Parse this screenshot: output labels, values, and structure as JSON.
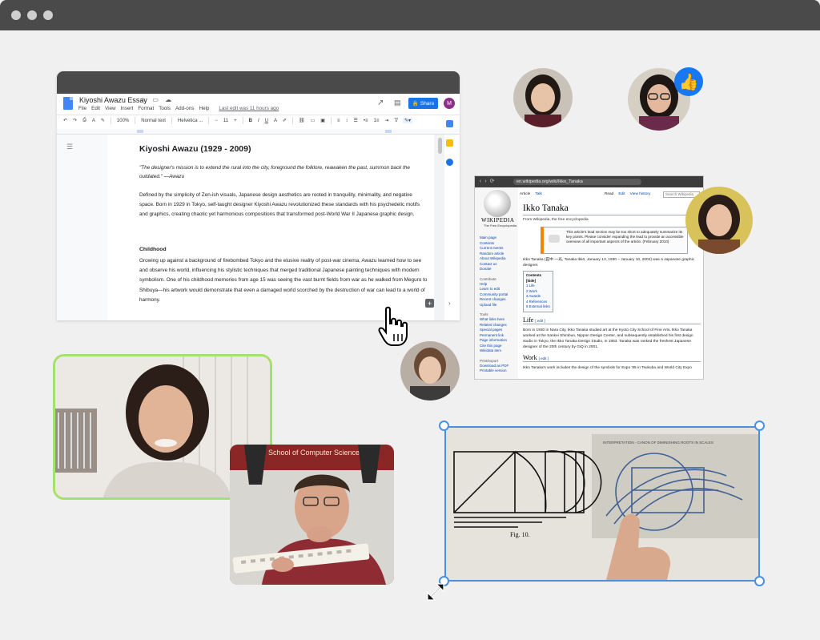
{
  "doc": {
    "title": "Kiyoshi Awazu Essay",
    "menu": [
      "File",
      "Edit",
      "View",
      "Insert",
      "Format",
      "Tools",
      "Add-ons",
      "Help"
    ],
    "last_edit": "Last edit was 11 hours ago",
    "share_label": "Share",
    "avatar_initial": "M",
    "toolbar": {
      "zoom": "100%",
      "style": "Normal text",
      "font": "Helvetica ...",
      "size": "11"
    },
    "heading": "Kiyoshi Awazu (1929 - 2009)",
    "quote": "\"The designer's mission is to extend the rural into the city, foreground the folklore, reawaken the past, summon back the outdated.\" —Awazu",
    "para1": "Defined by the simplicity of Zen-ish visuals, Japanese design aesthetics are rooted in tranquility, minimality, and negative space. Born in 1929 in Tokyo, self-taught designer Kiyoshi Awazu revolutionized these standards with his psychedelic motifs and graphics, creating chaotic yet harmonious compositions that transformed post-World War II Japanese graphic design.",
    "section": "Childhood",
    "para2": "Growing up against a background of firebombed Tokyo and the elusive reality of post-war cinema, Awazu learned how to see and observe his world, influencing his stylistic techniques that merged traditional Japanese painting techniques with modern symbolism. One of his childhood memories from age 15 was seeing the vast burnt fields from war as he walked from Meguro to Shibuya—his artwork would demonstrate that even a damaged world scorched by the destruction of war can lead to a world of harmony."
  },
  "wiki": {
    "url": "en.wikipedia.org/wiki/Ikko_Tanaka",
    "brand": "WIKIPEDIA",
    "tagline": "The Free Encyclopedia",
    "tabs_left": [
      "Article",
      "Talk"
    ],
    "tabs_right": [
      "Read",
      "Edit",
      "View history"
    ],
    "search_placeholder": "Search Wikipedia",
    "side_links": [
      "Main page",
      "Contents",
      "Current events",
      "Random article",
      "About Wikipedia",
      "Contact us",
      "Donate"
    ],
    "contribute_heading": "Contribute",
    "contribute_links": [
      "Help",
      "Learn to edit",
      "Community portal",
      "Recent changes",
      "Upload file"
    ],
    "tools_heading": "Tools",
    "tools_links": [
      "What links here",
      "Related changes",
      "Special pages",
      "Permanent link",
      "Page information",
      "Cite this page",
      "Wikidata item"
    ],
    "print_heading": "Print/export",
    "print_links": [
      "Download as PDF",
      "Printable version"
    ],
    "title": "Ikko Tanaka",
    "from": "From Wikipedia, the free encyclopedia",
    "notice": "This article's lead section may be too short to adequately summarize its key points. Please consider expanding the lead to provide an accessible overview of all important aspects of the article. (February 2010)",
    "lead": "Ikko Tanaka (田中 一光, Tanaka Ikkō, January 13, 1930 – January 10, 2002) was a Japanese graphic designer.",
    "toc_title": "Contents [hide]",
    "toc": [
      "1 Life",
      "2 Work",
      "3 Awards",
      "4 References",
      "5 External links"
    ],
    "h_life": "Life",
    "life_text": "Born in 1930 in Nara City, Ikko Tanaka studied art at the Kyoto City School of Fine Arts. Ikko Tanaka worked at the Sankei Shimbun, Nippon Design Center, and subsequently established his first design studio in Tokyo, the Ikko Tanaka Design Studio, in 1963. Tanaka was ranked the freshest Japanese designer of the 20th century by GiQ in 2001.",
    "h_work": "Work",
    "work_text": "Ikko Tanaka's work includes the design of the symbols for Expo '85 in Tsukuba and World City Expo",
    "edit_link": "[ edit ]"
  },
  "screen_share": {
    "header_text": "INTERPRETATION - CANON OF DIMINISHING ROOTS IN SCALES",
    "fig_label": "Fig. 10."
  },
  "banner_text": "School of Computer Science",
  "colors": {
    "accent_blue": "#4a90e2",
    "speaker_green": "#a7e06a",
    "share_button": "#1a73e8",
    "like_badge": "#1877f2"
  }
}
